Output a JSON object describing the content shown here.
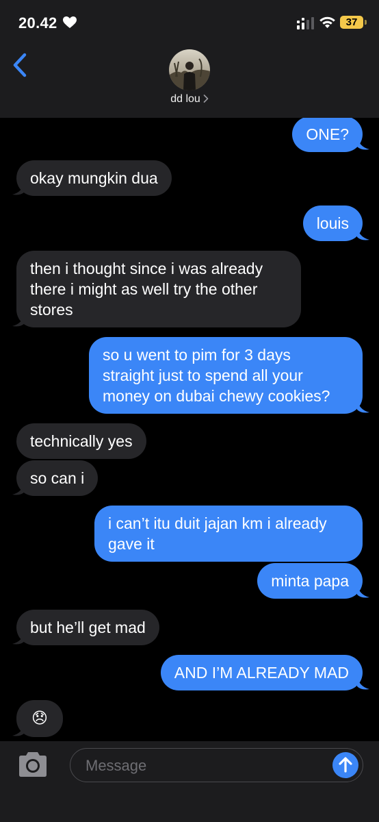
{
  "status_bar": {
    "time": "20.42",
    "battery_level": "37",
    "heart_icon": "heart-icon",
    "signal_icon": "signal-icon",
    "wifi_icon": "wifi-icon"
  },
  "header": {
    "contact_name": "dd lou",
    "back_icon": "chevron-left-icon",
    "name_chevron_icon": "chevron-right-icon"
  },
  "messages": [
    {
      "from": "me",
      "text": "ONE?"
    },
    {
      "from": "them",
      "text": "okay mungkin dua"
    },
    {
      "from": "me",
      "text": "louis"
    },
    {
      "from": "them",
      "lines": [
        "then i thought since i was already",
        "there i might as well try the other",
        "stores"
      ]
    },
    {
      "from": "me",
      "lines": [
        "so u went to pim for 3 days",
        "straight just to spend all your",
        "money on dubai chewy cookies?"
      ]
    },
    {
      "from": "them",
      "text": "technically yes"
    },
    {
      "from": "them",
      "text": "so can i"
    },
    {
      "from": "me",
      "lines": [
        "i can’t itu duit jajan km i already",
        "gave it"
      ]
    },
    {
      "from": "me",
      "text": "minta papa"
    },
    {
      "from": "them",
      "text": "but he’ll get mad"
    },
    {
      "from": "me",
      "text": "AND I’M ALREADY MAD"
    },
    {
      "from": "them",
      "text": "😞"
    }
  ],
  "input_bar": {
    "placeholder": "Message",
    "value": "",
    "camera_icon": "camera-icon",
    "send_icon": "arrow-up-icon"
  },
  "colors": {
    "outgoing_bubble": "#3b86f7",
    "incoming_bubble": "#262629",
    "background": "#000000",
    "header_background": "#1c1c1e",
    "battery": "#f4c84a"
  }
}
